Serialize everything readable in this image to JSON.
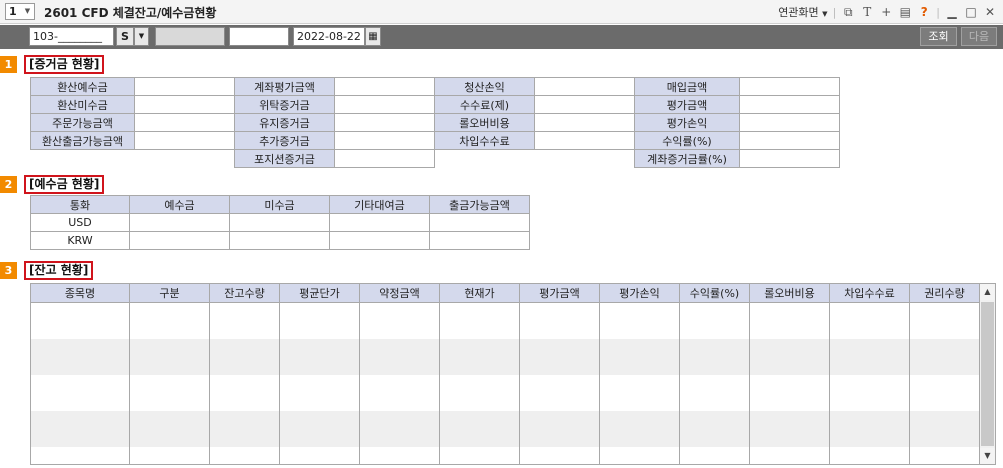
{
  "titlebar": {
    "screen_number": "1",
    "title": "2601 CFD 체결잔고/예수금현황",
    "linked_screen": "연관화면",
    "icons": [
      "screen-capture-icon",
      "text-icon",
      "plus-icon",
      "print-icon",
      "help-icon",
      "minimize-icon",
      "maximize-icon",
      "close-icon"
    ],
    "help_glyph": "?"
  },
  "toolbar": {
    "account_value": "103-________",
    "account_type": "S",
    "date_value": "2022-08-22",
    "query_label": "조회",
    "next_label": "다음"
  },
  "sections": {
    "s1": {
      "num": "1",
      "title": "[증거금 현황]"
    },
    "s2": {
      "num": "2",
      "title": "[예수금 현황]"
    },
    "s3": {
      "num": "3",
      "title": "[잔고 현황]"
    }
  },
  "margin": {
    "col1": [
      "환산예수금",
      "환산미수금",
      "주문가능금액",
      "환산출금가능금액"
    ],
    "col2": [
      "계좌평가금액",
      "위탁증거금",
      "유지증거금",
      "추가증거금",
      "포지션증거금"
    ],
    "col3": [
      "청산손익",
      "수수료(제)",
      "롤오버비용",
      "차입수수료"
    ],
    "col4": [
      "매입금액",
      "평가금액",
      "평가손익",
      "수익률(%)",
      "계좌증거금률(%)"
    ]
  },
  "deposit": {
    "headers": [
      "통화",
      "예수금",
      "미수금",
      "기타대여금",
      "출금가능금액"
    ],
    "currencies": [
      "USD",
      "KRW"
    ]
  },
  "holdings": {
    "headers": [
      "종목명",
      "구분",
      "잔고수량",
      "평균단가",
      "약정금액",
      "현재가",
      "평가금액",
      "평가손익",
      "수익률(%)",
      "롤오버비용",
      "차입수수료",
      "권리수량"
    ]
  }
}
